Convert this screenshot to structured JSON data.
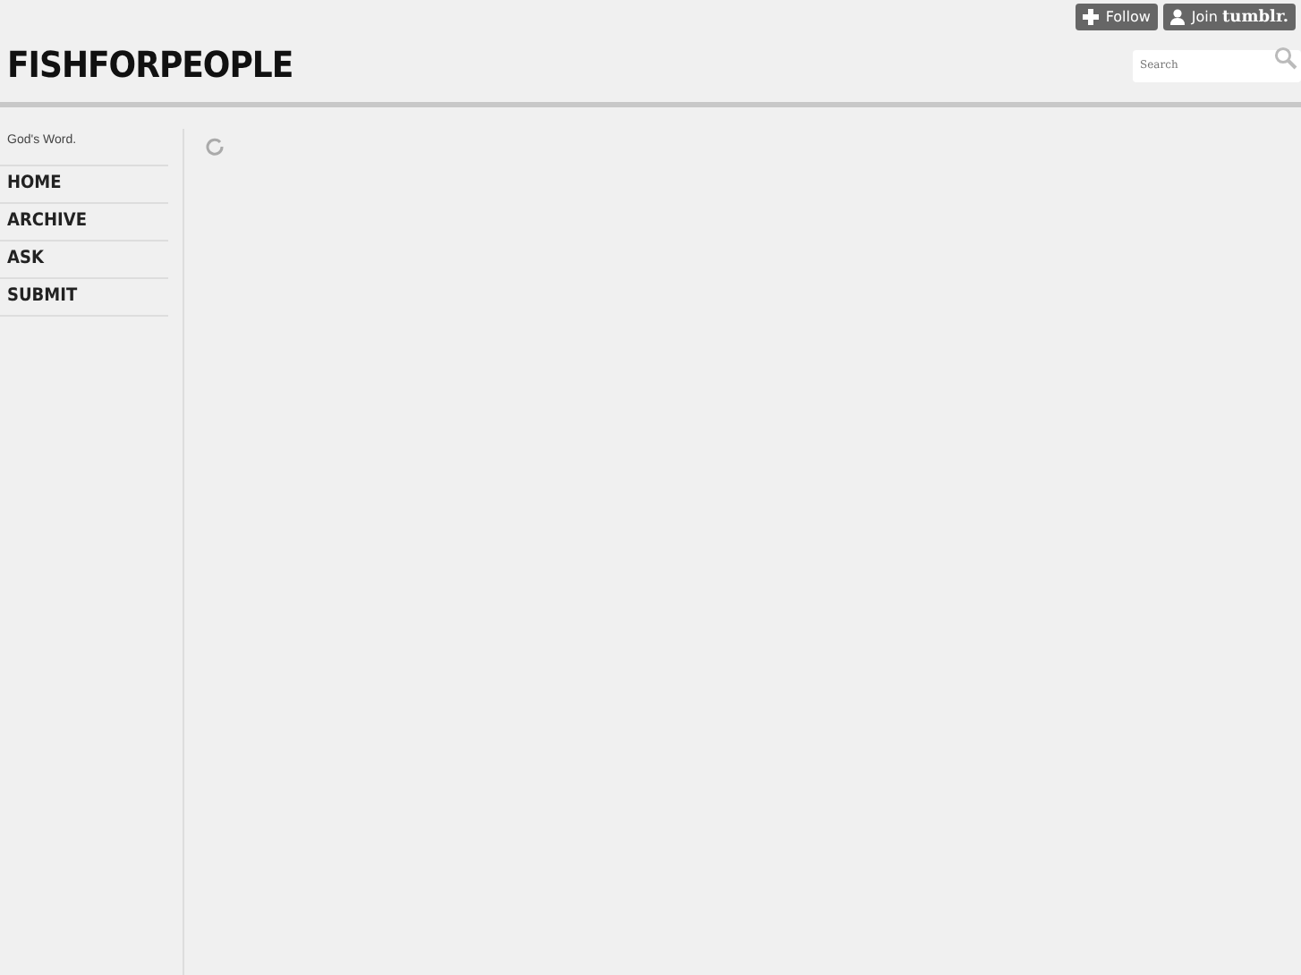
{
  "toolbar": {
    "follow_button": "Follow",
    "join_button": "Join **tumblr.**"
  },
  "header": {
    "title": "FISHFORPEOPLE",
    "search": {
      "placeholder": "Search"
    }
  },
  "sidebar": {
    "tagline": "God's Word.",
    "nav": [
      {
        "label": "HOME"
      },
      {
        "label": "ARCHIVE"
      },
      {
        "label": "ASK"
      },
      {
        "label": "SUBMIT"
      }
    ]
  }
}
